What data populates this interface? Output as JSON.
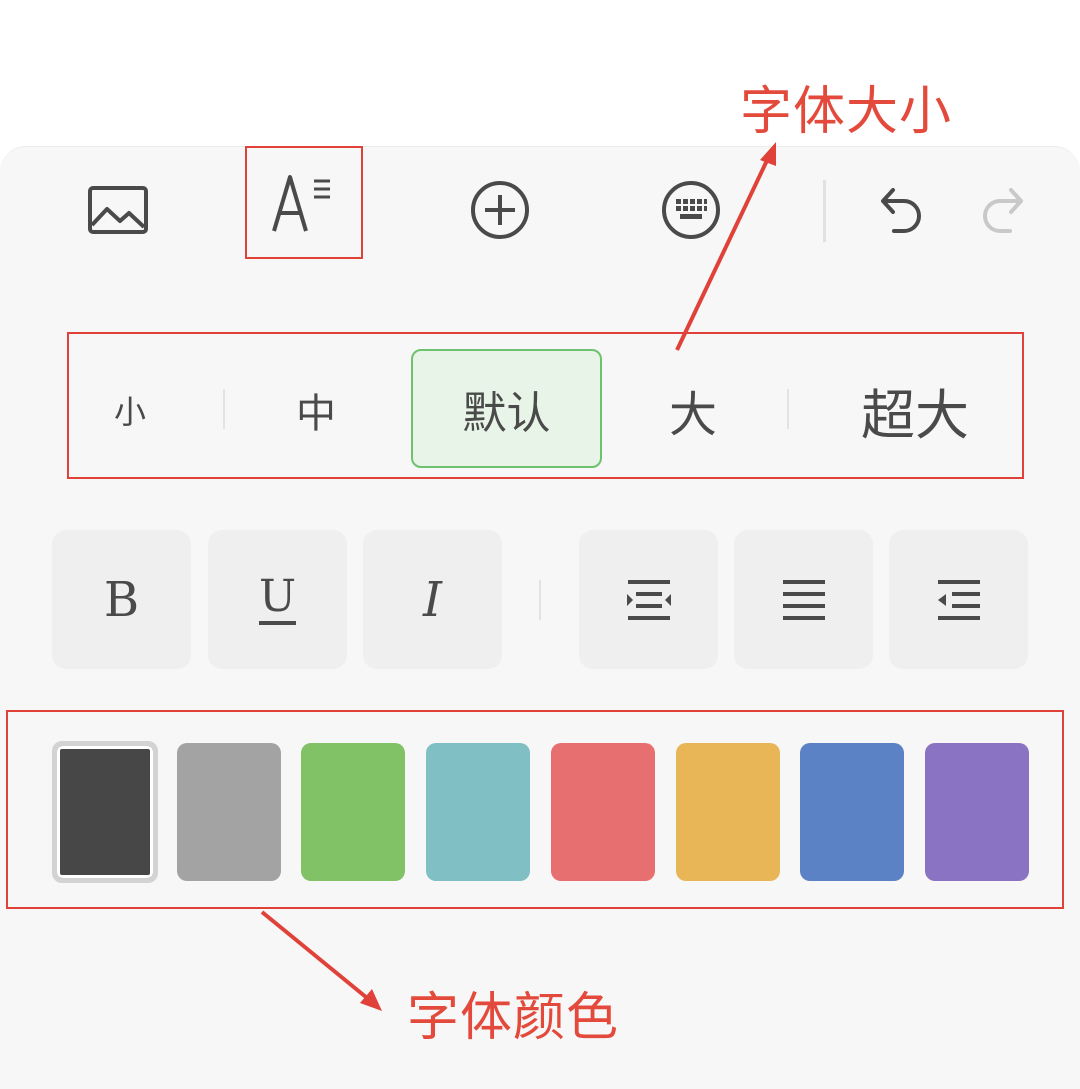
{
  "toolbar": {
    "icons": [
      "image-icon",
      "font-style-icon",
      "add-circle-icon",
      "keyboard-icon",
      "undo-icon",
      "redo-icon"
    ]
  },
  "font_size": {
    "options": [
      "小",
      "中",
      "默认",
      "大",
      "超大"
    ],
    "selected": "默认"
  },
  "format": {
    "bold_label": "B",
    "underline_label": "U",
    "italic_label": "I",
    "align_icons": [
      "align-center-icon",
      "align-justify-icon",
      "indent-icon"
    ]
  },
  "colors": {
    "swatches": [
      "#474747",
      "#a3a3a3",
      "#82c266",
      "#80bfc4",
      "#e86f6f",
      "#e8b656",
      "#5b82c4",
      "#8a73c2"
    ],
    "selected_index": 0
  },
  "annotations": {
    "size_label": "字体大小",
    "color_label": "字体颜色",
    "accent": "#e34a3c"
  }
}
